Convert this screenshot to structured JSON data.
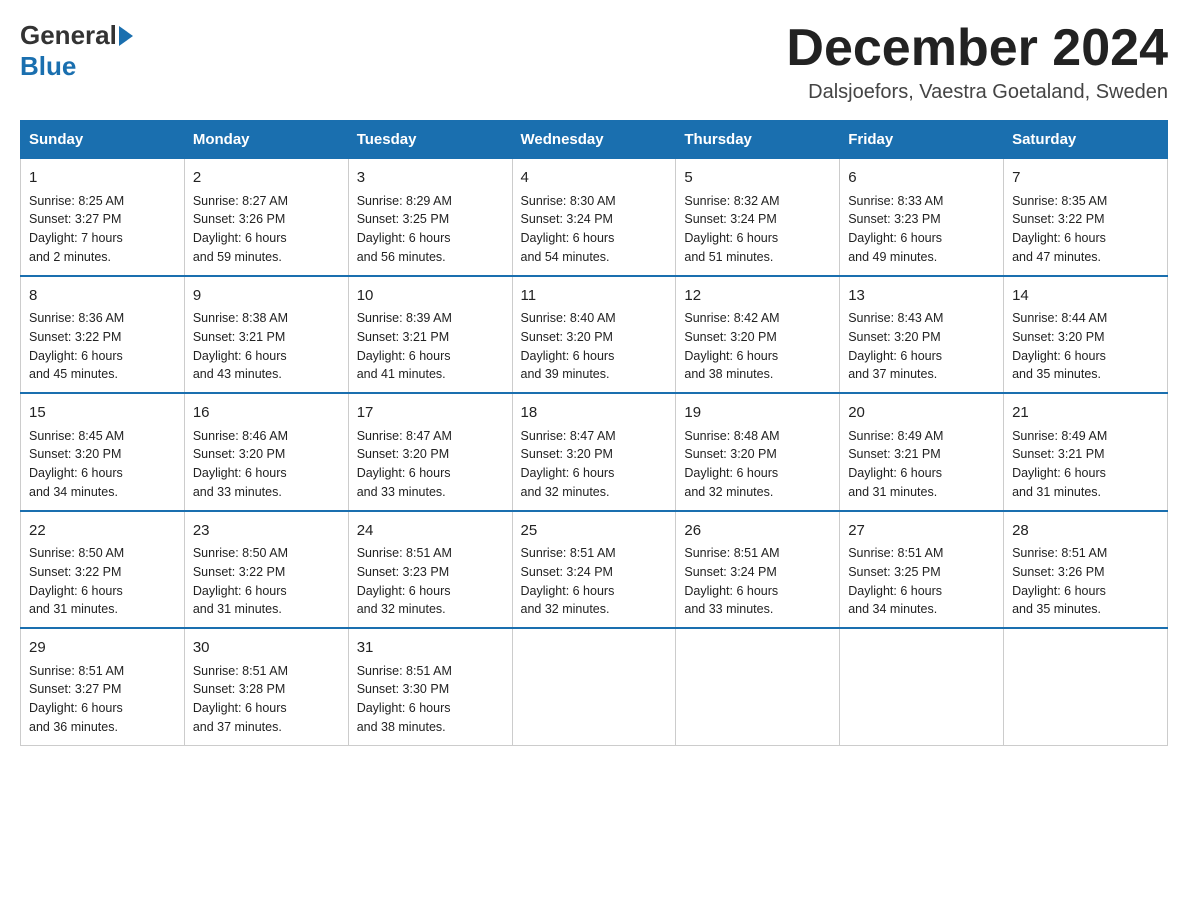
{
  "header": {
    "title": "December 2024",
    "subtitle": "Dalsjoefors, Vaestra Goetaland, Sweden",
    "logo_general": "General",
    "logo_blue": "Blue"
  },
  "weekdays": [
    "Sunday",
    "Monday",
    "Tuesday",
    "Wednesday",
    "Thursday",
    "Friday",
    "Saturday"
  ],
  "weeks": [
    [
      {
        "day": "1",
        "sunrise": "8:25 AM",
        "sunset": "3:27 PM",
        "daylight": "7 hours and 2 minutes."
      },
      {
        "day": "2",
        "sunrise": "8:27 AM",
        "sunset": "3:26 PM",
        "daylight": "6 hours and 59 minutes."
      },
      {
        "day": "3",
        "sunrise": "8:29 AM",
        "sunset": "3:25 PM",
        "daylight": "6 hours and 56 minutes."
      },
      {
        "day": "4",
        "sunrise": "8:30 AM",
        "sunset": "3:24 PM",
        "daylight": "6 hours and 54 minutes."
      },
      {
        "day": "5",
        "sunrise": "8:32 AM",
        "sunset": "3:24 PM",
        "daylight": "6 hours and 51 minutes."
      },
      {
        "day": "6",
        "sunrise": "8:33 AM",
        "sunset": "3:23 PM",
        "daylight": "6 hours and 49 minutes."
      },
      {
        "day": "7",
        "sunrise": "8:35 AM",
        "sunset": "3:22 PM",
        "daylight": "6 hours and 47 minutes."
      }
    ],
    [
      {
        "day": "8",
        "sunrise": "8:36 AM",
        "sunset": "3:22 PM",
        "daylight": "6 hours and 45 minutes."
      },
      {
        "day": "9",
        "sunrise": "8:38 AM",
        "sunset": "3:21 PM",
        "daylight": "6 hours and 43 minutes."
      },
      {
        "day": "10",
        "sunrise": "8:39 AM",
        "sunset": "3:21 PM",
        "daylight": "6 hours and 41 minutes."
      },
      {
        "day": "11",
        "sunrise": "8:40 AM",
        "sunset": "3:20 PM",
        "daylight": "6 hours and 39 minutes."
      },
      {
        "day": "12",
        "sunrise": "8:42 AM",
        "sunset": "3:20 PM",
        "daylight": "6 hours and 38 minutes."
      },
      {
        "day": "13",
        "sunrise": "8:43 AM",
        "sunset": "3:20 PM",
        "daylight": "6 hours and 37 minutes."
      },
      {
        "day": "14",
        "sunrise": "8:44 AM",
        "sunset": "3:20 PM",
        "daylight": "6 hours and 35 minutes."
      }
    ],
    [
      {
        "day": "15",
        "sunrise": "8:45 AM",
        "sunset": "3:20 PM",
        "daylight": "6 hours and 34 minutes."
      },
      {
        "day": "16",
        "sunrise": "8:46 AM",
        "sunset": "3:20 PM",
        "daylight": "6 hours and 33 minutes."
      },
      {
        "day": "17",
        "sunrise": "8:47 AM",
        "sunset": "3:20 PM",
        "daylight": "6 hours and 33 minutes."
      },
      {
        "day": "18",
        "sunrise": "8:47 AM",
        "sunset": "3:20 PM",
        "daylight": "6 hours and 32 minutes."
      },
      {
        "day": "19",
        "sunrise": "8:48 AM",
        "sunset": "3:20 PM",
        "daylight": "6 hours and 32 minutes."
      },
      {
        "day": "20",
        "sunrise": "8:49 AM",
        "sunset": "3:21 PM",
        "daylight": "6 hours and 31 minutes."
      },
      {
        "day": "21",
        "sunrise": "8:49 AM",
        "sunset": "3:21 PM",
        "daylight": "6 hours and 31 minutes."
      }
    ],
    [
      {
        "day": "22",
        "sunrise": "8:50 AM",
        "sunset": "3:22 PM",
        "daylight": "6 hours and 31 minutes."
      },
      {
        "day": "23",
        "sunrise": "8:50 AM",
        "sunset": "3:22 PM",
        "daylight": "6 hours and 31 minutes."
      },
      {
        "day": "24",
        "sunrise": "8:51 AM",
        "sunset": "3:23 PM",
        "daylight": "6 hours and 32 minutes."
      },
      {
        "day": "25",
        "sunrise": "8:51 AM",
        "sunset": "3:24 PM",
        "daylight": "6 hours and 32 minutes."
      },
      {
        "day": "26",
        "sunrise": "8:51 AM",
        "sunset": "3:24 PM",
        "daylight": "6 hours and 33 minutes."
      },
      {
        "day": "27",
        "sunrise": "8:51 AM",
        "sunset": "3:25 PM",
        "daylight": "6 hours and 34 minutes."
      },
      {
        "day": "28",
        "sunrise": "8:51 AM",
        "sunset": "3:26 PM",
        "daylight": "6 hours and 35 minutes."
      }
    ],
    [
      {
        "day": "29",
        "sunrise": "8:51 AM",
        "sunset": "3:27 PM",
        "daylight": "6 hours and 36 minutes."
      },
      {
        "day": "30",
        "sunrise": "8:51 AM",
        "sunset": "3:28 PM",
        "daylight": "6 hours and 37 minutes."
      },
      {
        "day": "31",
        "sunrise": "8:51 AM",
        "sunset": "3:30 PM",
        "daylight": "6 hours and 38 minutes."
      },
      null,
      null,
      null,
      null
    ]
  ]
}
